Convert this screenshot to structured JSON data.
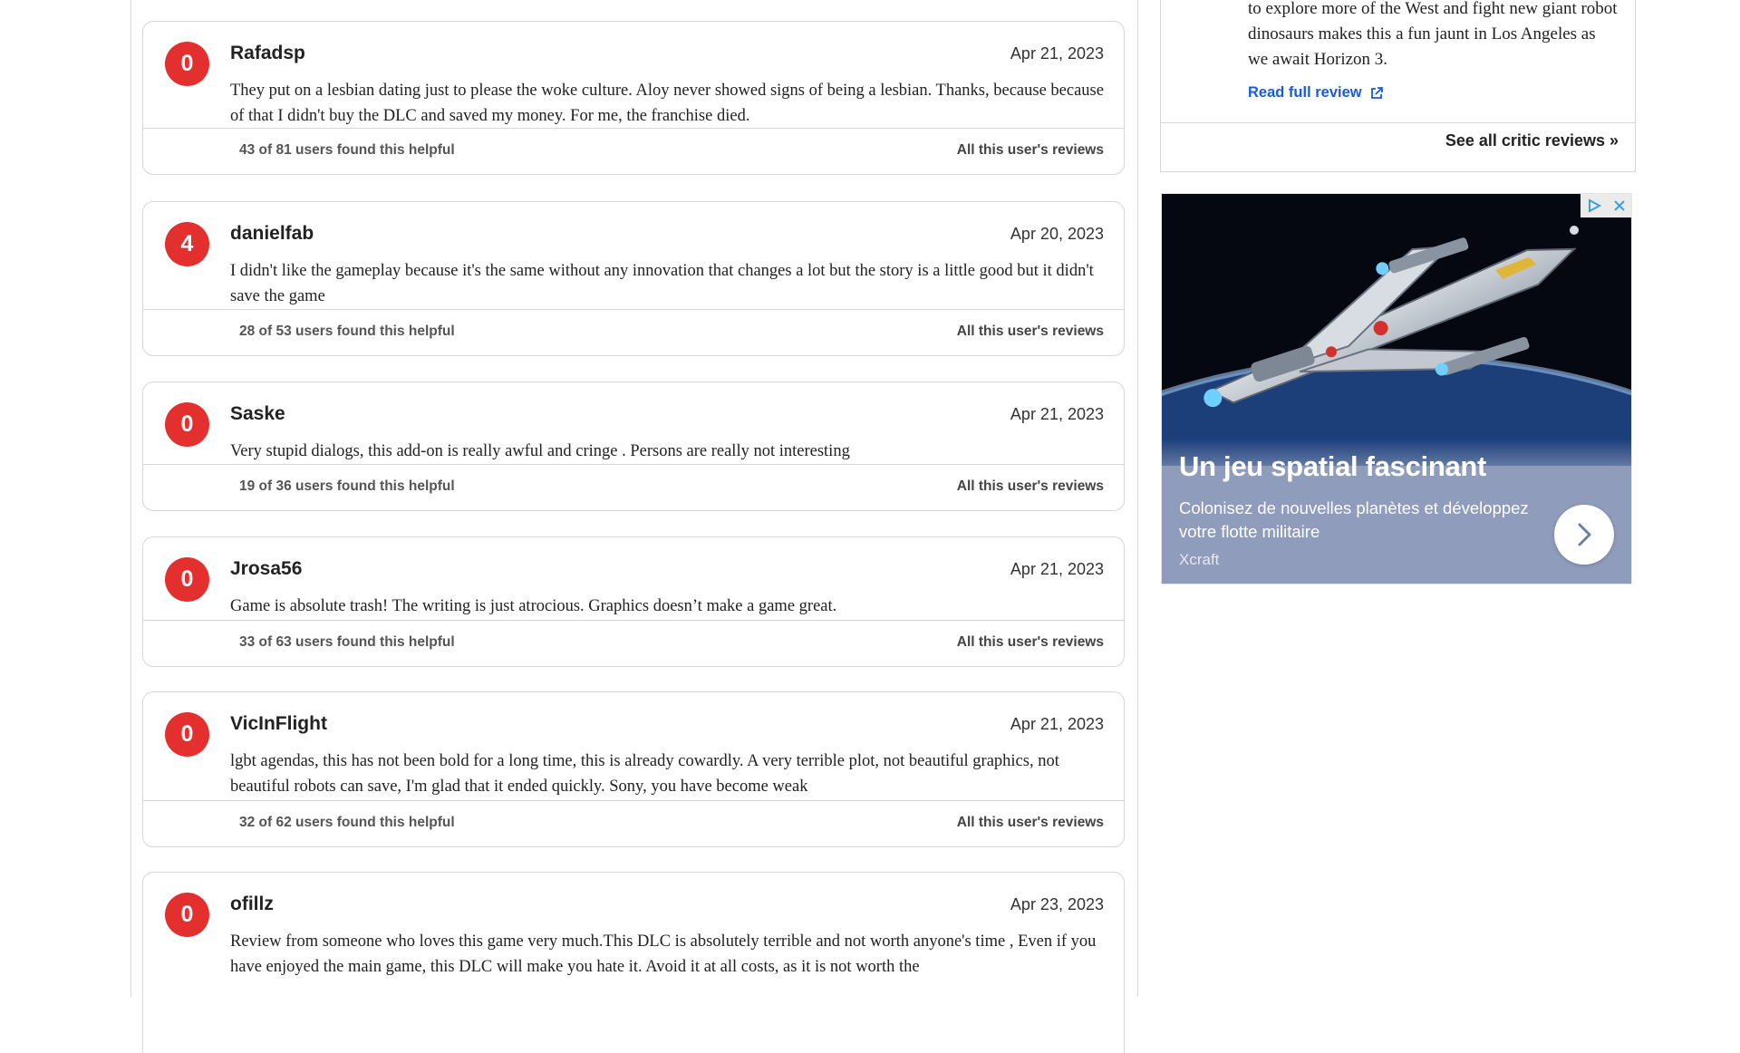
{
  "reviews": [
    {
      "score": "0",
      "user": "Rafadsp",
      "date": "Apr 21, 2023",
      "text": "They put on a lesbian dating just to please the woke culture. Aloy never showed signs of being a lesbian. Thanks, because because of that I didn't buy the DLC and saved my money. For me, the franchise died.",
      "helpful": "43 of 81 users found this helpful",
      "all_reviews": "All this user's reviews"
    },
    {
      "score": "4",
      "user": "danielfab",
      "date": "Apr 20, 2023",
      "text": "I didn't like the gameplay because it's the same without any innovation that changes a lot but the story is a little good but it didn't save the game",
      "helpful": "28 of 53 users found this helpful",
      "all_reviews": "All this user's reviews"
    },
    {
      "score": "0",
      "user": "Saske",
      "date": "Apr 21, 2023",
      "text": "Very stupid dialogs, this add-on is really awful and cringe . Persons are really not interesting",
      "helpful": "19 of 36 users found this helpful",
      "all_reviews": "All this user's reviews"
    },
    {
      "score": "0",
      "user": "Jrosa56",
      "date": "Apr 21, 2023",
      "text": "Game is absolute trash! The writing is just atrocious. Graphics doesn’t make a game great.",
      "helpful": "33 of 63 users found this helpful",
      "all_reviews": "All this user's reviews"
    },
    {
      "score": "0",
      "user": "VicInFlight",
      "date": "Apr 21, 2023",
      "text": "lgbt agendas, this has not been bold for a long time, this is already cowardly. A very terrible plot, not beautiful graphics, not beautiful robots can save, I'm glad that it ended quickly. Sony, you have become weak",
      "helpful": "32 of 62 users found this helpful",
      "all_reviews": "All this user's reviews"
    },
    {
      "score": "0",
      "user": "ofillz",
      "date": "Apr 23, 2023",
      "text": "Review from someone who loves this game very much.This DLC is absolutely terrible and not worth anyone's time , Even if you have enjoyed the main game, this DLC will make you hate it. Avoid it at all costs, as it is not worth the",
      "helpful": "",
      "all_reviews": ""
    }
  ],
  "critic": {
    "text": "to explore more of the West and fight new giant robot dinosaurs makes this a fun jaunt in Los Angeles as we await Horizon 3.",
    "read_full": "Read full review",
    "see_all": "See all critic reviews »"
  },
  "ad": {
    "title": "Un jeu spatial fascinant",
    "description": "Colonisez de nouvelles planètes et développez votre flotte militaire",
    "brand": "Xcraft"
  },
  "colors": {
    "score_red": "#e3302f",
    "link_blue": "#1a5bd6"
  }
}
